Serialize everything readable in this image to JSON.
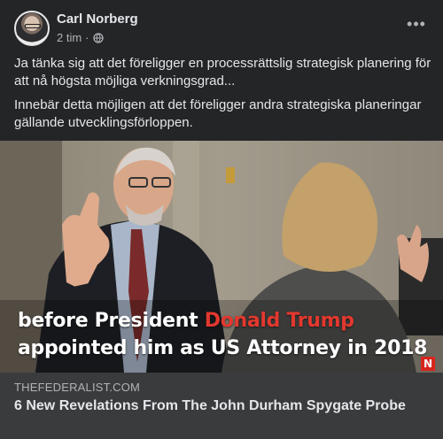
{
  "post": {
    "author": "Carl Norberg",
    "time": "2 tim",
    "separator": "·",
    "privacy_icon": "globe-icon",
    "more_icon": "more-options-icon",
    "paragraphs": [
      "Ja tänka sig att det föreligger en processrättslig strategisk planering för att nå högsta möjliga verkningsgrad...",
      "Innebär detta möjligen att det föreligger andra strategiska planeringar gällande utvecklingsförloppen."
    ]
  },
  "image": {
    "caption_line1_prefix": "before President ",
    "caption_line1_highlight": "Donald Trump",
    "caption_line2": "appointed him as US Attorney in 2018",
    "brand_mark": "N",
    "highlight_color": "#e2382e"
  },
  "link_preview": {
    "domain": "THEFEDERALIST.COM",
    "title": "6 New Revelations From The John Durham Spygate Probe"
  },
  "colors": {
    "background": "#242526",
    "link_background": "#3a3b3c",
    "primary_text": "#e4e6eb",
    "secondary_text": "#b0b3b8"
  }
}
